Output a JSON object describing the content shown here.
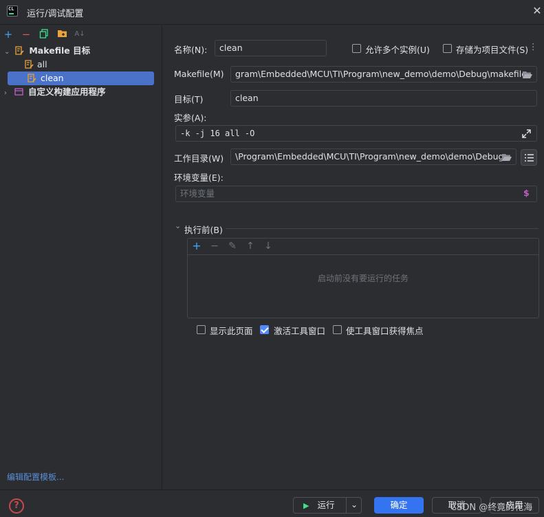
{
  "window": {
    "title": "运行/调试配置",
    "close_icon": "close-icon"
  },
  "tree_toolbar": {
    "icons": [
      "add-icon",
      "remove-icon",
      "copy-icon",
      "folder-add-icon",
      "sort-icon"
    ]
  },
  "tree": {
    "group_makefile": "Makefile 目标",
    "item_all": "all",
    "item_clean": "clean",
    "group_custom": "自定义构建应用程序"
  },
  "edit_templates": "编辑配置模板...",
  "form": {
    "name_label": "名称(N):",
    "name_value": "clean",
    "allow_multiple_label": "允许多个实例(U)",
    "allow_multiple_checked": false,
    "store_project_label": "存储为项目文件(S)",
    "store_project_checked": false,
    "makefile_label": "Makefile(M)",
    "makefile_value": "gram\\Embedded\\MCU\\TI\\Program\\new_demo\\demo\\Debug\\makefile",
    "target_label": "目标(T)",
    "target_value": "clean",
    "args_label": "实参(A):",
    "args_value": "-k -j 16 all -O",
    "workdir_label": "工作目录(W)",
    "workdir_value": "\\Program\\Embedded\\MCU\\TI\\Program\\new_demo\\demo\\Debug",
    "env_label": "环境变量(E):",
    "env_placeholder": "环境变量",
    "env_dollar": "$"
  },
  "before_launch": {
    "title": "执行前(B)",
    "empty_text": "启动前没有要运行的任务"
  },
  "options": {
    "show_page_label": "显示此页面",
    "show_page_checked": false,
    "activate_tool_label": "激活工具窗口",
    "activate_tool_checked": true,
    "focus_tool_label": "使工具窗口获得焦点",
    "focus_tool_checked": false
  },
  "buttons": {
    "run": "运行",
    "ok": "确定",
    "cancel": "取消",
    "apply": "应用"
  },
  "watermark": "CSDN @终竟的花海",
  "colors": {
    "accent": "#3574f0",
    "selection": "#4a72c8",
    "link": "#5a8fd8",
    "makefile_icon": "#e8a33d",
    "custom_icon": "#c45ec8"
  }
}
